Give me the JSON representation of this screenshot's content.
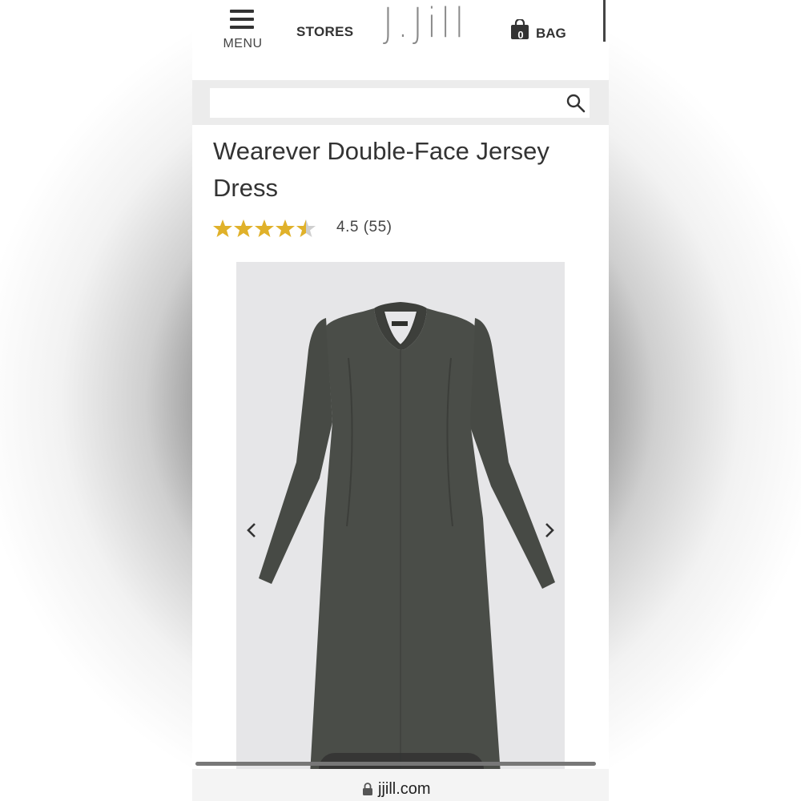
{
  "header": {
    "menu_label": "MENU",
    "stores_label": "STORES",
    "logo_text": "J.Jill",
    "bag_count": "0",
    "bag_label": "BAG"
  },
  "search": {
    "placeholder": "",
    "value": ""
  },
  "product": {
    "title": "Wearever Double-Face Jersey Dress",
    "rating_value": 4.5,
    "rating_max": 5,
    "rating_text": "4.5 (55)",
    "image_alt": "Long-sleeve dark olive jersey midi dress with keyhole neckline"
  },
  "browser": {
    "url": "jjill.com"
  },
  "colors": {
    "star_fill": "#e0b12a",
    "star_empty": "#cfcfcf",
    "dress": "#4a4d48",
    "image_bg": "#e6e6e8",
    "text": "#333333"
  },
  "icons": {
    "menu": "hamburger-icon",
    "bag": "shopping-bag-icon",
    "search": "search-icon",
    "prev": "chevron-left-icon",
    "next": "chevron-right-icon",
    "lock": "lock-icon"
  }
}
